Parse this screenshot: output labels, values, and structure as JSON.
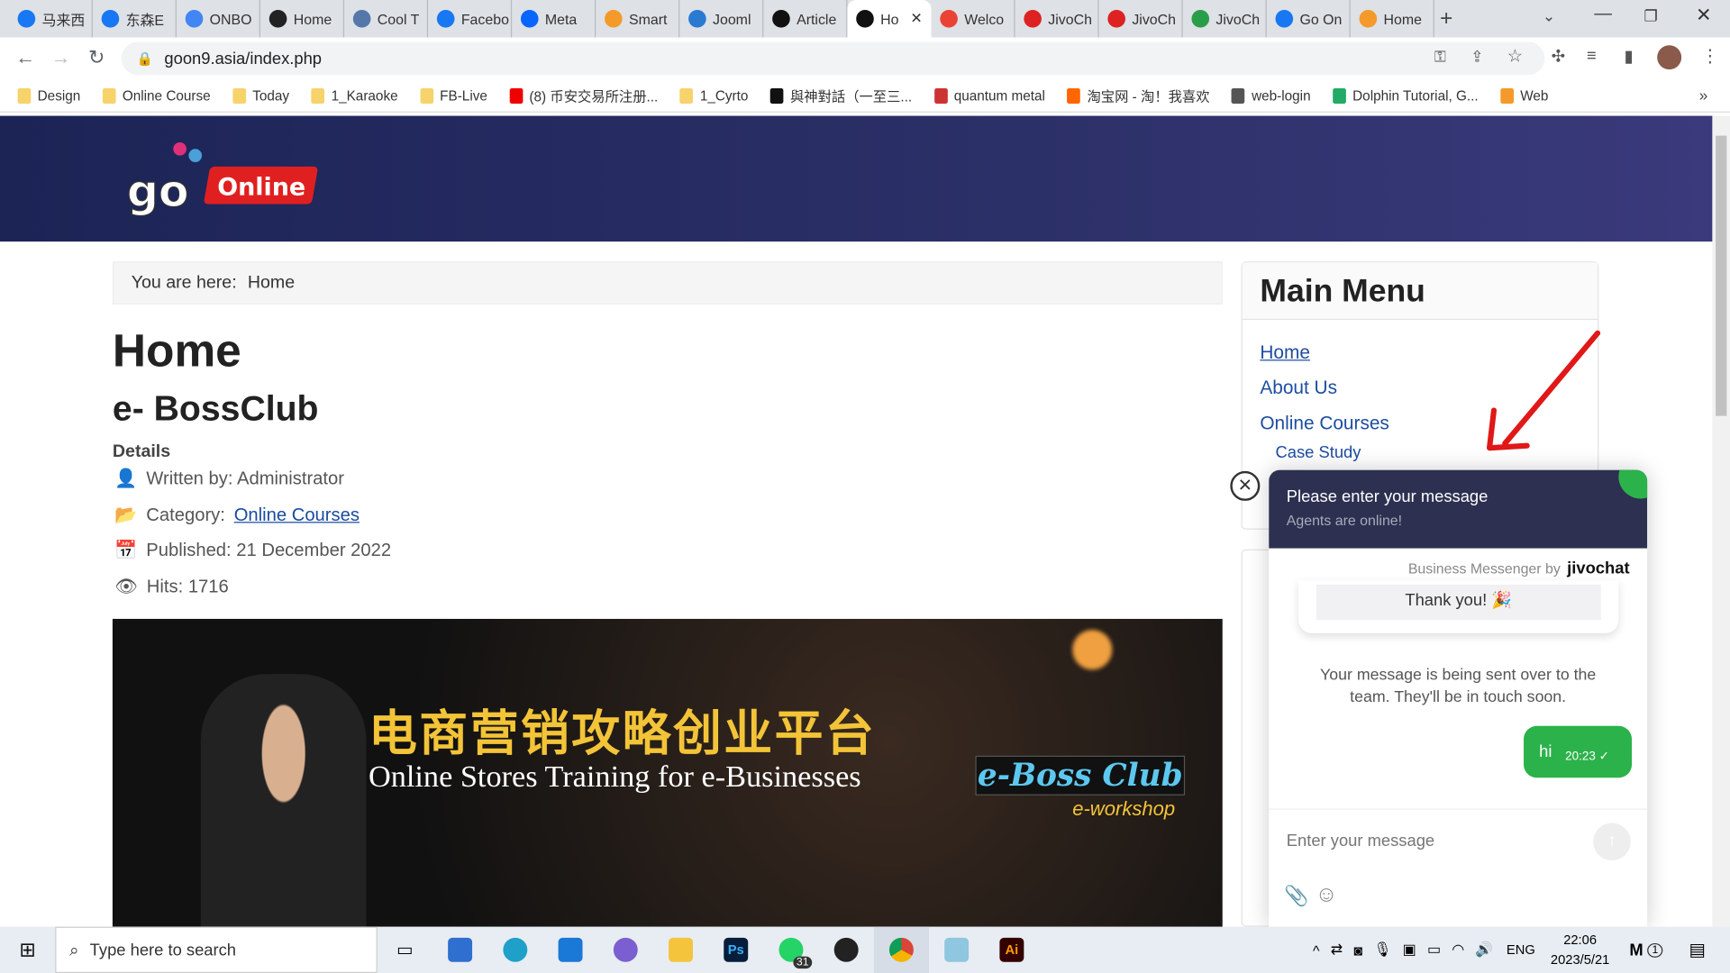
{
  "browser": {
    "tabs": [
      {
        "label": "马来西",
        "icon": "facebook",
        "color": "#1877f2"
      },
      {
        "label": "东森E",
        "icon": "facebook",
        "color": "#1877f2"
      },
      {
        "label": "ONBO",
        "icon": "docs",
        "color": "#4285f4"
      },
      {
        "label": "Home",
        "icon": "strawberry",
        "color": "#222"
      },
      {
        "label": "Cool T",
        "icon": "link",
        "color": "#5577aa"
      },
      {
        "label": "Facebo",
        "icon": "facebook",
        "color": "#1877f2"
      },
      {
        "label": "Meta",
        "icon": "meta",
        "color": "#0866ff"
      },
      {
        "label": "Smart",
        "icon": "joomla",
        "color": "#f39a2b"
      },
      {
        "label": "Jooml",
        "icon": "fd",
        "color": "#2a7ad2"
      },
      {
        "label": "Article",
        "icon": "joomla-black",
        "color": "#111"
      },
      {
        "label": "Ho",
        "icon": "joomla-black",
        "color": "#111",
        "active": true
      },
      {
        "label": "Welco",
        "icon": "gmail",
        "color": "#ea4335"
      },
      {
        "label": "JivoCh",
        "icon": "jivo",
        "color": "#d22"
      },
      {
        "label": "JivoCh",
        "icon": "jivo",
        "color": "#d22"
      },
      {
        "label": "JivoCh",
        "icon": "leaf",
        "color": "#2a9d4a"
      },
      {
        "label": "Go On",
        "icon": "facebook",
        "color": "#1877f2"
      },
      {
        "label": "Home",
        "icon": "joomla",
        "color": "#f39a2b"
      }
    ],
    "url": "goon9.asia/index.php",
    "bookmarks": [
      {
        "label": "Design",
        "icon": "folder"
      },
      {
        "label": "Online Course",
        "icon": "folder"
      },
      {
        "label": "Today",
        "icon": "folder"
      },
      {
        "label": "1_Karaoke",
        "icon": "folder"
      },
      {
        "label": "FB-Live",
        "icon": "folder"
      },
      {
        "label": "(8) 币安交易所注册...",
        "icon": "youtube"
      },
      {
        "label": "1_Cyrto",
        "icon": "folder"
      },
      {
        "label": "與神對話（一至三...",
        "icon": "book"
      },
      {
        "label": "quantum metal",
        "icon": "qm"
      },
      {
        "label": "淘宝网 - 淘！我喜欢",
        "icon": "taobao"
      },
      {
        "label": "web-login",
        "icon": "globe"
      },
      {
        "label": "Dolphin Tutorial, G...",
        "icon": "dolphin"
      },
      {
        "label": "Web",
        "icon": "joomla"
      }
    ],
    "more_bookmarks": "»"
  },
  "site": {
    "logo_text": "go Online",
    "breadcrumb_label": "You are here:",
    "breadcrumb_current": "Home",
    "page_title": "Home",
    "article_title": "e- BossClub",
    "details_label": "Details",
    "written_by": "Written by: Administrator",
    "category_label": "Category:",
    "category_link": "Online Courses",
    "published": "Published: 21 December 2022",
    "hits": "Hits: 1716",
    "banner": {
      "cn_title": "电商营销攻略创业平台",
      "en_title": "Online Stores Training for e-Businesses",
      "brand": "e-Boss Club",
      "sub": "e-workshop"
    }
  },
  "sidebar": {
    "title": "Main Menu",
    "items": [
      {
        "label": "Home"
      },
      {
        "label": "About Us"
      },
      {
        "label": "Online Courses"
      },
      {
        "label": "Case Study",
        "sub": true
      }
    ]
  },
  "chat": {
    "header_title": "Please enter your message",
    "header_sub": "Agents are online!",
    "powered": "Business Messenger by",
    "brand": "jivochat",
    "thanks": "Thank you! 🎉",
    "system_msg": "Your message is being sent over to the team. They'll be in touch soon.",
    "user_msg": "hi",
    "user_time": "20:23 ✓",
    "input_placeholder": "Enter your message"
  },
  "taskbar": {
    "search_placeholder": "Type here to search",
    "lang": "ENG",
    "time": "22:06",
    "date": "2023/5/21",
    "whatsapp_badge": "31",
    "notif_badge": "1"
  }
}
